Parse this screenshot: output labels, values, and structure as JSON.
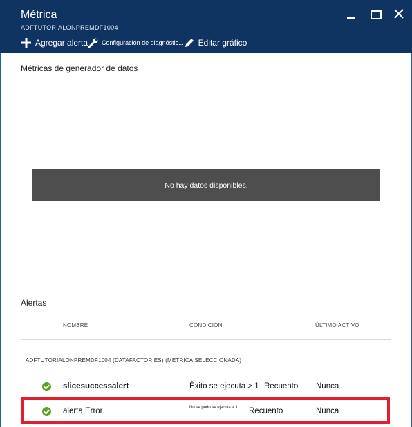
{
  "window": {
    "title": "Métrica",
    "subtitle": "ADFTUTORIALONPREMDF1004"
  },
  "toolbar": {
    "add_alert": "Agregar alerta",
    "diag_settings": "Configuración de diagnóstic...",
    "edit_chart": "Editar gráfico"
  },
  "chart": {
    "title": "Métricas de generador de datos",
    "no_data": "No hay datos disponibles."
  },
  "alerts": {
    "title": "Alertas",
    "columns": {
      "name": "NOMBRE",
      "condition": "CONDICIÓN",
      "last_active": "ÚLTIMO ACTIVO"
    },
    "group": "ADFTUTORIALONPREMDF1004 (DATAFACTORIES) (MÉTRICA SELECCIONADA)",
    "rows": [
      {
        "name": "slicesuccessalert",
        "condition": "Éxito se ejecuta > 1",
        "aggregation": "Recuento",
        "last_active": "Nunca",
        "status": "success"
      },
      {
        "name": "alerta Error",
        "condition": "No se pudo se ejecuta > 1",
        "aggregation": "Recuento",
        "last_active": "Nunca",
        "status": "success"
      }
    ]
  },
  "colors": {
    "header": "#0f3462",
    "accent": "#1e5fa8",
    "success": "#5aa21f",
    "highlight": "#e0202e"
  }
}
